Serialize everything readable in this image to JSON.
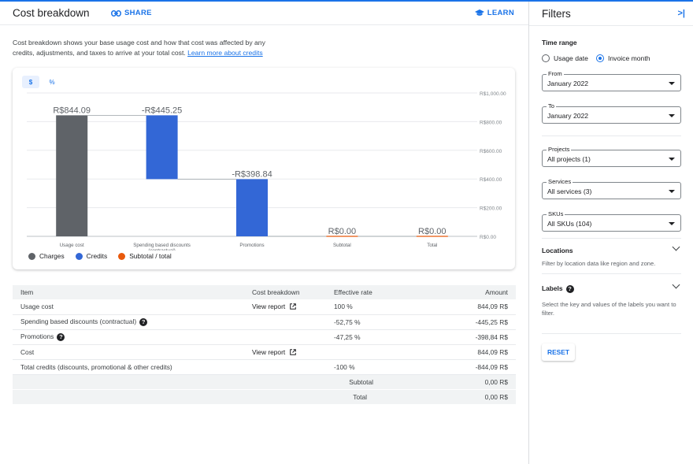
{
  "header": {
    "title": "Cost breakdown",
    "share_label": "SHARE",
    "learn_label": "LEARN"
  },
  "description": {
    "text": "Cost breakdown shows your base usage cost and how that cost was affected by any credits, adjustments, and taxes to arrive at your total cost.",
    "link": "Learn more about credits"
  },
  "chart_toggle": {
    "dollar": "$",
    "percent": "%",
    "selected": "$"
  },
  "colors": {
    "charges": "#5f6368",
    "credits": "#3367d6",
    "subtotal": "#e8590c",
    "accent": "#1a73e8"
  },
  "chart_data": {
    "type": "bar",
    "subtype": "waterfall",
    "categories": [
      "Usage cost",
      "Spending based discounts (contractual)",
      "Promotions",
      "Subtotal",
      "Total"
    ],
    "bars": [
      {
        "category": "Usage cost",
        "kind": "charges",
        "start": 0,
        "end": 844.09,
        "label": "R$844.09"
      },
      {
        "category": "Spending based discounts (contractual)",
        "kind": "credits",
        "start": 844.09,
        "end": 398.84,
        "label": "-R$445.25"
      },
      {
        "category": "Promotions",
        "kind": "credits",
        "start": 398.84,
        "end": 0,
        "label": "-R$398.84"
      },
      {
        "category": "Subtotal",
        "kind": "subtotal",
        "start": 0,
        "end": 0,
        "label": "R$0.00"
      },
      {
        "category": "Total",
        "kind": "subtotal",
        "start": 0,
        "end": 0,
        "label": "R$0.00"
      }
    ],
    "ylim": [
      0,
      1000
    ],
    "yticks": [
      0,
      200,
      400,
      600,
      800,
      1000
    ],
    "ytick_labels": [
      "R$0.00",
      "R$200.00",
      "R$400.00",
      "R$600.00",
      "R$800.00",
      "R$1,000.00"
    ],
    "legend": [
      "Charges",
      "Credits",
      "Subtotal / total"
    ],
    "legend_position": "bottom-left",
    "grid": true
  },
  "table": {
    "headers": {
      "item": "Item",
      "breakdown": "Cost breakdown",
      "rate": "Effective rate",
      "amount": "Amount"
    },
    "rows": [
      {
        "item": "Usage cost",
        "breakdown": "View report",
        "rate": "100 %",
        "amount": "844,09 R$"
      },
      {
        "item": "Spending based discounts (contractual)",
        "breakdown": "",
        "rate": "-52,75 %",
        "amount": "-445,25 R$"
      },
      {
        "item": "Promotions",
        "breakdown": "",
        "rate": "-47,25 %",
        "amount": "-398,84 R$"
      },
      {
        "item": "Cost",
        "breakdown": "View report",
        "rate": "",
        "amount": "844,09 R$"
      },
      {
        "item": "Total credits (discounts, promotional & other credits)",
        "breakdown": "",
        "rate": "-100 %",
        "amount": "-844,09 R$"
      }
    ],
    "subtotal": {
      "label": "Subtotal",
      "amount": "0,00 R$"
    },
    "total": {
      "label": "Total",
      "amount": "0,00 R$"
    }
  },
  "filters": {
    "title": "Filters",
    "time_range_label": "Time range",
    "usage_date": "Usage date",
    "invoice_month": "Invoice month",
    "selected_range": "Invoice month",
    "from_label": "From",
    "from_value": "January 2022",
    "to_label": "To",
    "to_value": "January 2022",
    "projects_label": "Projects",
    "projects_value": "All projects (1)",
    "services_label": "Services",
    "services_value": "All services (3)",
    "skus_label": "SKUs",
    "skus_value": "All SKUs (104)",
    "locations_label": "Locations",
    "locations_help": "Filter by location data like region and zone.",
    "labels_label": "Labels",
    "labels_help": "Select the key and values of the labels you want to filter.",
    "reset_label": "RESET"
  }
}
